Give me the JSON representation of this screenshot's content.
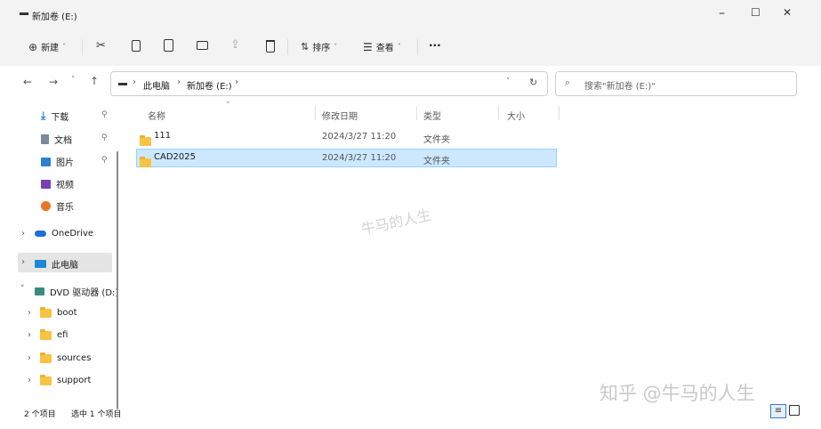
{
  "window": {
    "title": "新加卷 (E:)",
    "controls": {
      "minimize": "–",
      "maximize": "☐",
      "close": "✕"
    }
  },
  "toolbar": {
    "new_label": "新建",
    "sort_label": "排序",
    "view_label": "查看",
    "more_label": "···"
  },
  "address": {
    "crumbs": [
      "此电脑",
      "新加卷 (E:)"
    ],
    "search_placeholder": "搜索\"新加卷 (E:)\""
  },
  "sidebar": {
    "quick": [
      {
        "label": "下载",
        "icon": "download-icon"
      },
      {
        "label": "文档",
        "icon": "document-icon"
      },
      {
        "label": "图片",
        "icon": "picture-icon"
      },
      {
        "label": "视频",
        "icon": "video-icon"
      },
      {
        "label": "音乐",
        "icon": "music-icon"
      }
    ],
    "onedrive": "OneDrive",
    "thispc": "此电脑",
    "dvd": "DVD 驱动器 (D:)",
    "dvd_items": [
      "boot",
      "efi",
      "sources",
      "support"
    ]
  },
  "columns": {
    "name": "名称",
    "modified": "修改日期",
    "type": "类型",
    "size": "大小"
  },
  "files": [
    {
      "name": "111",
      "modified": "2024/3/27 11:20",
      "type": "文件夹",
      "size": ""
    },
    {
      "name": "CAD2025",
      "modified": "2024/3/27 11:20",
      "type": "文件夹",
      "size": ""
    }
  ],
  "status": {
    "count": "2 个项目",
    "selected": "选中 1 个项目"
  },
  "watermarks": {
    "center": "牛马的人生",
    "corner": "知乎 @牛马的人生"
  },
  "colors": {
    "selected_bg": "#cce8ff",
    "selected_border": "#99d1ff",
    "folder": "#f6c443",
    "chrome": "#f3f3f3"
  }
}
